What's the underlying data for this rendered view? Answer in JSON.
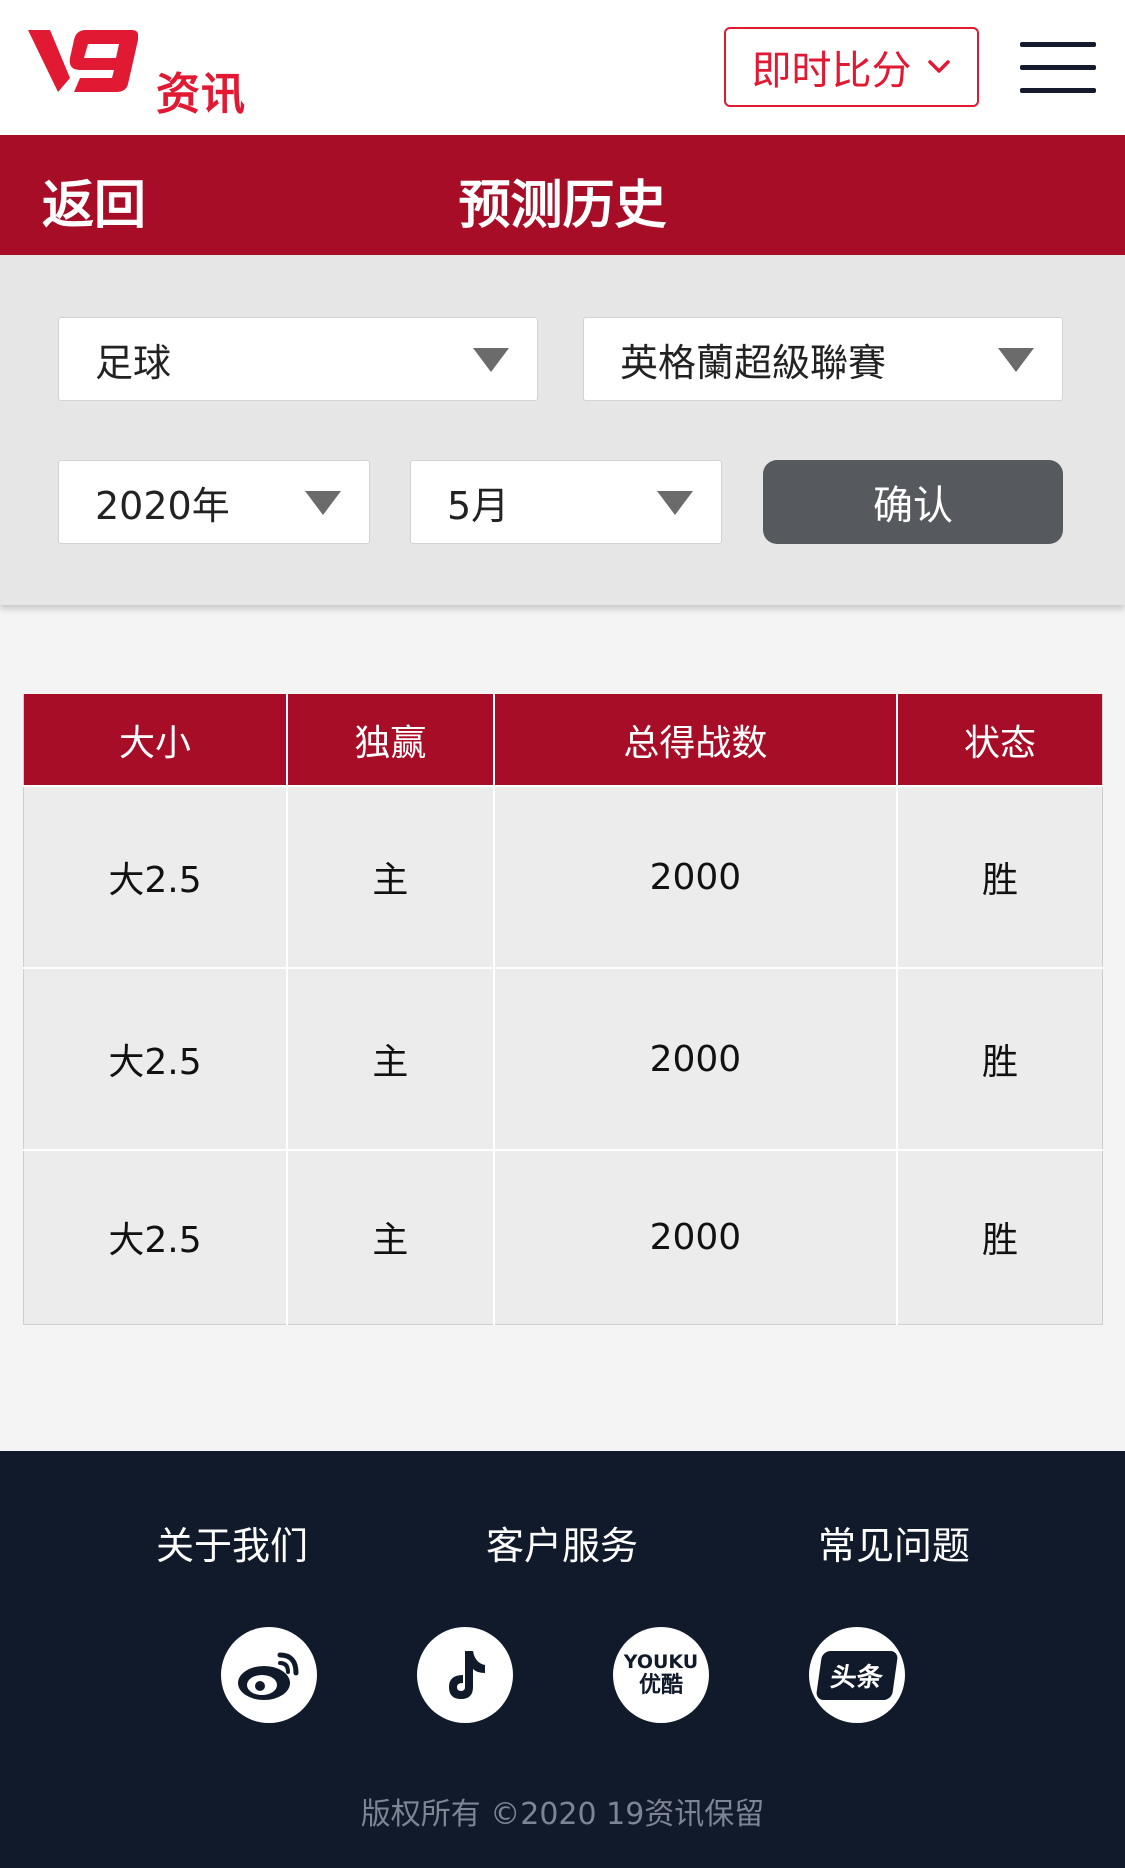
{
  "header": {
    "logo_text": "资讯",
    "live_score_label": "即时比分",
    "colors": {
      "brand_red": "#e21933",
      "bar_red": "#a80d27",
      "footer_bg": "#111a2b"
    }
  },
  "titlebar": {
    "back_label": "返回",
    "title": "预测历史"
  },
  "filters": {
    "sport": "足球",
    "league": "英格蘭超級聯賽",
    "year": "2020年",
    "month": "5月",
    "confirm_label": "确认"
  },
  "table": {
    "headers": [
      "大小",
      "独赢",
      "总得战数",
      "状态"
    ],
    "rows": [
      [
        "大2.5",
        "主",
        "2000",
        "胜"
      ],
      [
        "大2.5",
        "主",
        "2000",
        "胜"
      ],
      [
        "大2.5",
        "主",
        "2000",
        "胜"
      ]
    ]
  },
  "footer": {
    "links": [
      "关于我们",
      "客户服务",
      "常见问题"
    ],
    "social_icons": [
      "weibo-icon",
      "tiktok-icon",
      "youku-icon",
      "toutiao-icon"
    ],
    "youku_text_en": "YOUKU",
    "youku_text_cn": "优酷",
    "toutiao_text": "头条",
    "copyright": "版权所有 ©2020 19资讯保留"
  }
}
